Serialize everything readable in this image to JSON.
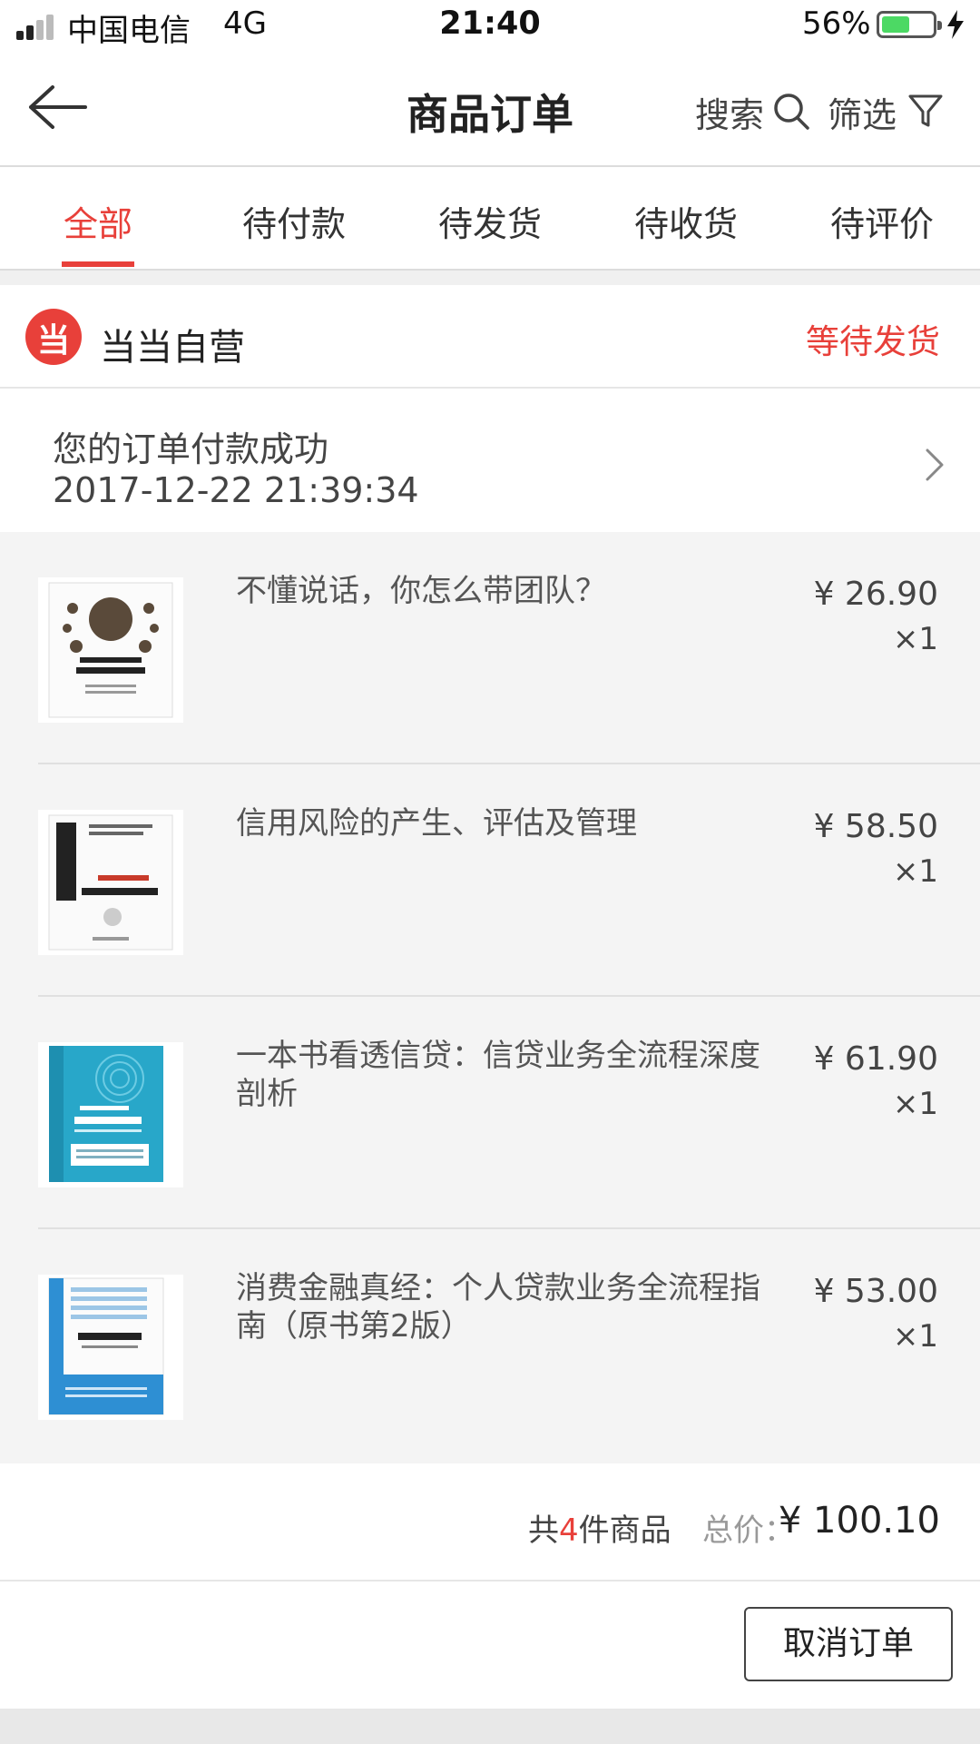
{
  "status_bar": {
    "carrier": "中国电信",
    "network": "4G",
    "time": "21:40",
    "battery": "56%",
    "battery_level": 0.56
  },
  "nav": {
    "title": "商品订单",
    "search_label": "搜索",
    "filter_label": "筛选"
  },
  "tabs": [
    {
      "label": "全部",
      "active": true
    },
    {
      "label": "待付款",
      "active": false
    },
    {
      "label": "待发货",
      "active": false
    },
    {
      "label": "待收货",
      "active": false
    },
    {
      "label": "待评价",
      "active": false
    }
  ],
  "shop": {
    "logo_char": "当",
    "name": "当当自营",
    "status": "等待发货"
  },
  "order_info": {
    "message": "您的订单付款成功",
    "time": "2017-12-22 21:39:34"
  },
  "items": [
    {
      "title": "不懂说话，你怎么带团队？",
      "price": "¥ 26.90",
      "qty": "×1",
      "cover_color": "#ffffff"
    },
    {
      "title": "信用风险的产生、评估及管理",
      "price": "¥ 58.50",
      "qty": "×1",
      "cover_color": "#ffffff"
    },
    {
      "title": "一本书看透信贷：信贷业务全流程深度剖析",
      "price": "¥ 61.90",
      "qty": "×1",
      "cover_color": "#28a7c9"
    },
    {
      "title": "消费金融真经：个人贷款业务全流程指南（原书第2版）",
      "price": "¥ 53.00",
      "qty": "×1",
      "cover_color": "#2e8fd3"
    }
  ],
  "summary": {
    "count_prefix": "共",
    "count": "4",
    "count_suffix": "件商品",
    "total_label": "总价：",
    "total": "¥ 100.10"
  },
  "actions": {
    "cancel_label": "取消订单"
  },
  "colors": {
    "accent": "#e8403a",
    "battery": "#4cd964"
  }
}
